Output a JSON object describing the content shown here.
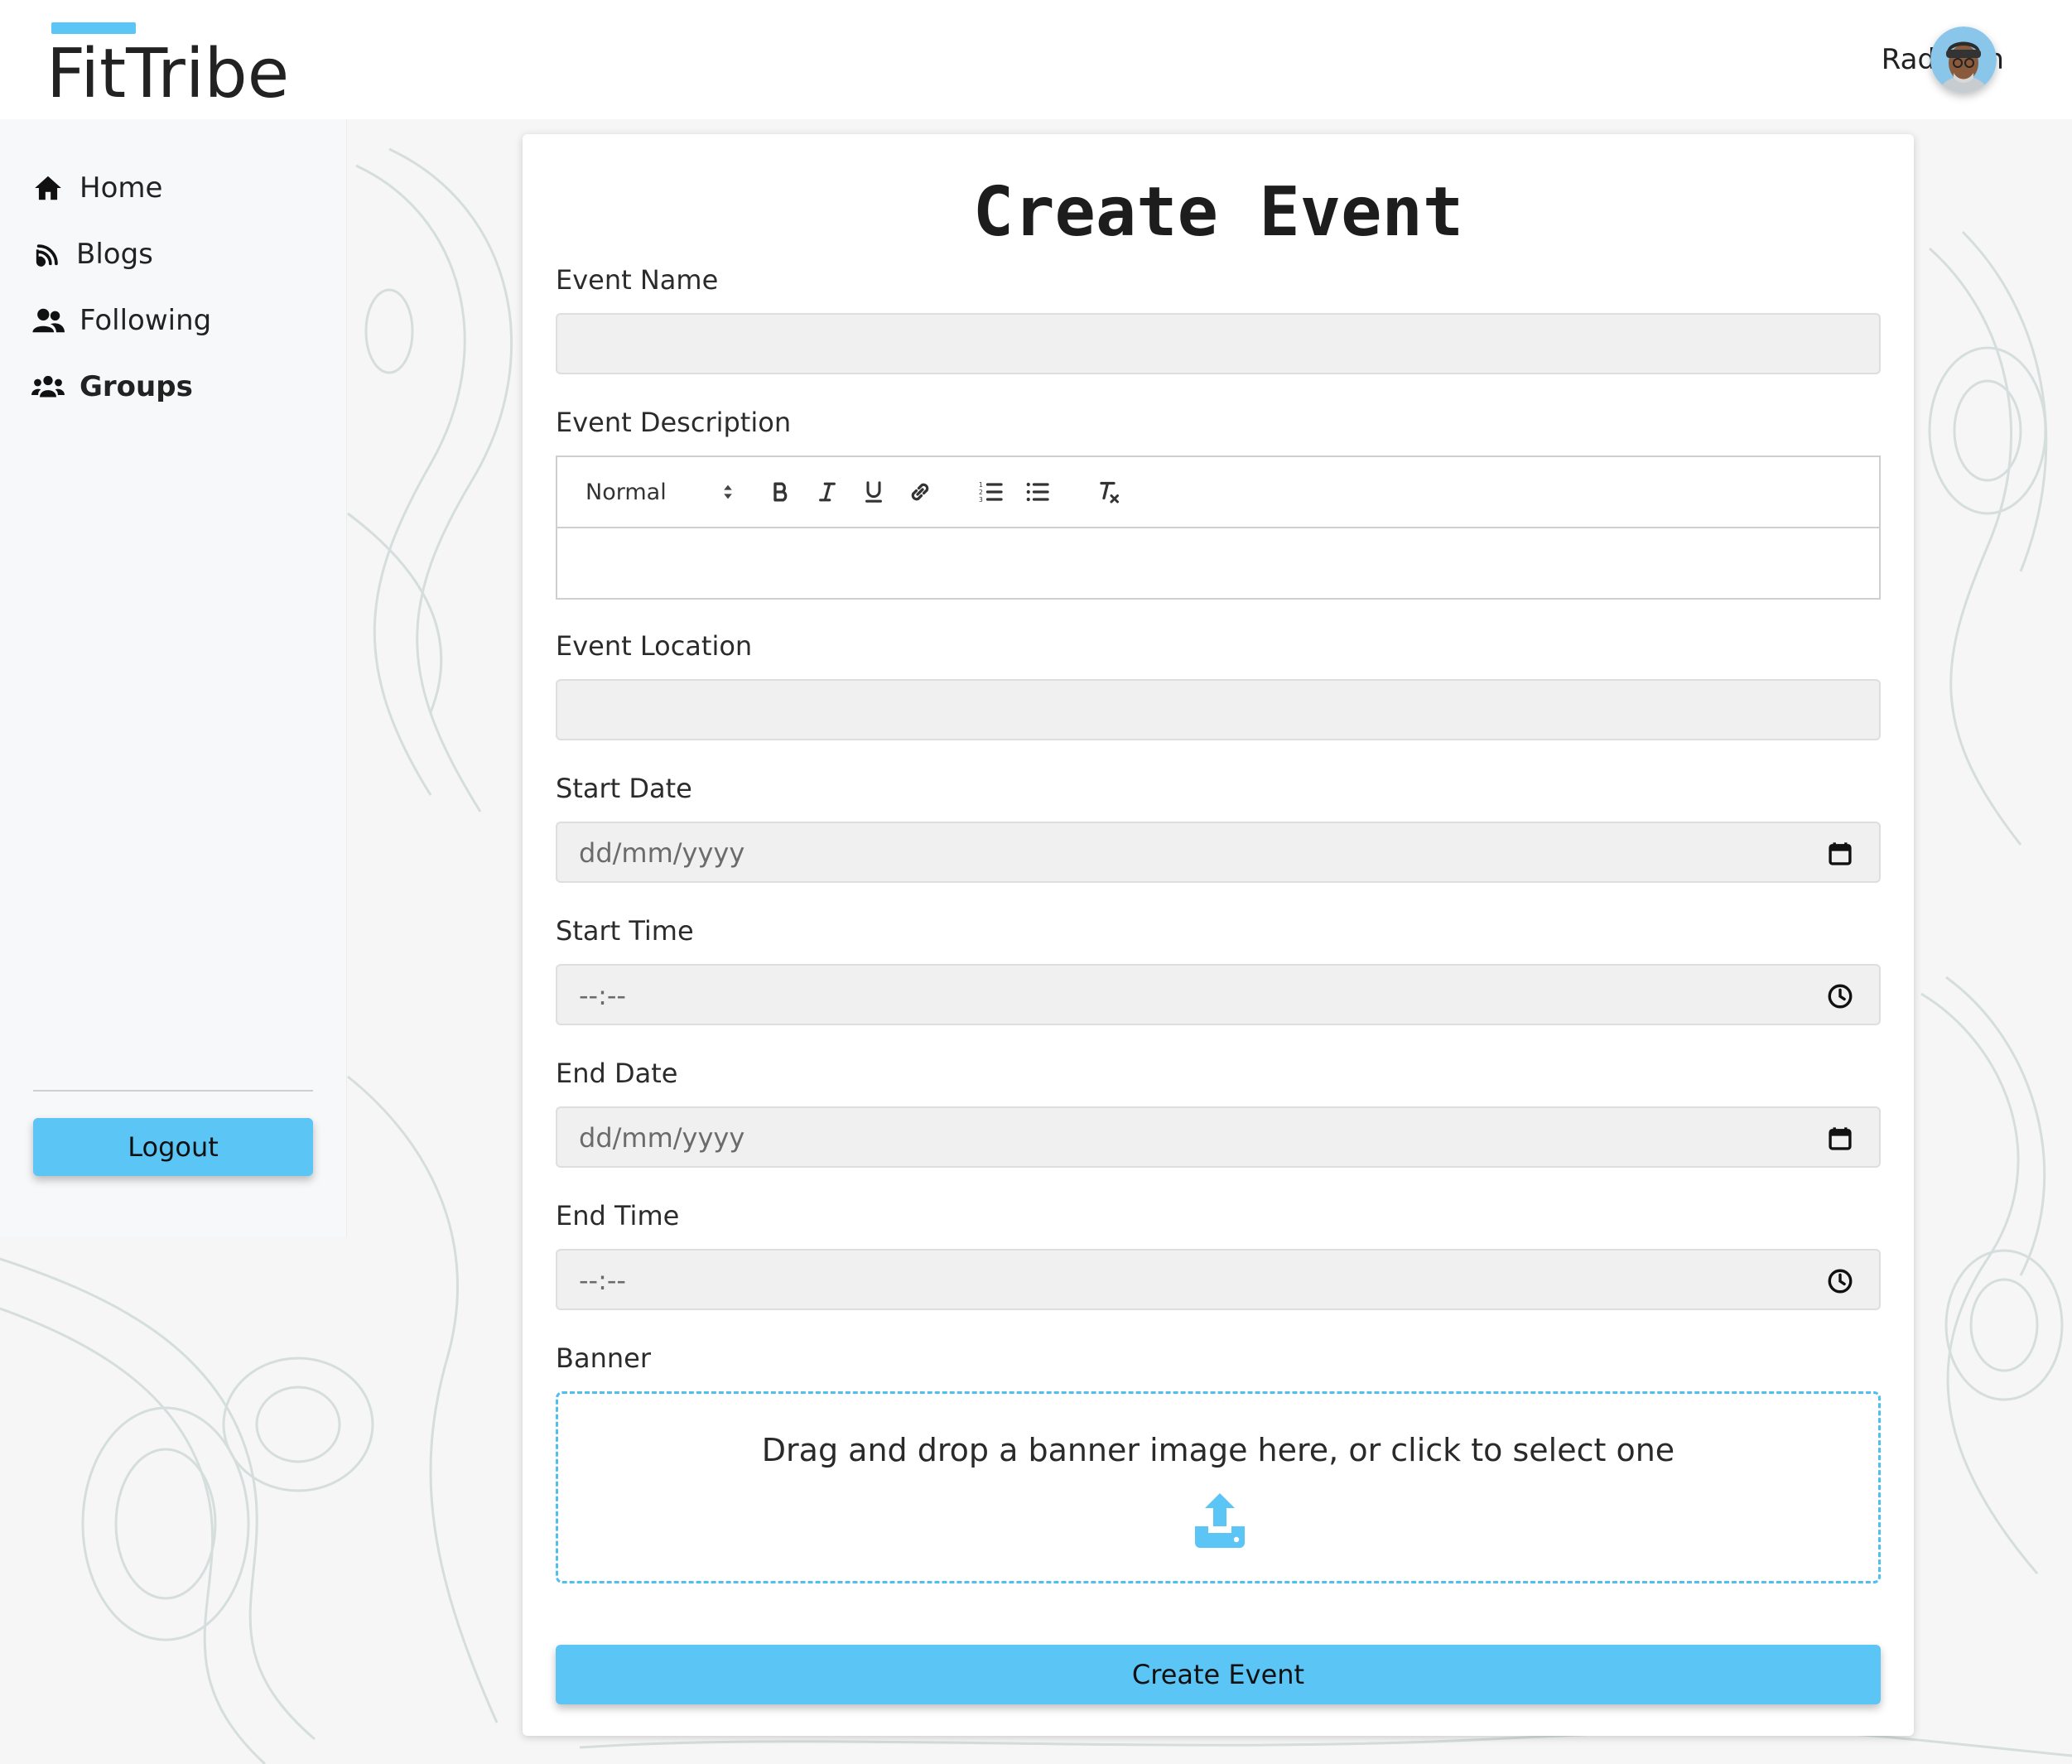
{
  "colors": {
    "accent": "#5bc5f6",
    "accent_dark": "#3fb2e8"
  },
  "header": {
    "logo_text": "FitTribe",
    "user_name": "Radleigh"
  },
  "sidebar": {
    "items": [
      {
        "label": "Home",
        "icon": "home-icon",
        "active": false
      },
      {
        "label": "Blogs",
        "icon": "rss-icon",
        "active": false
      },
      {
        "label": "Following",
        "icon": "user-group-icon",
        "active": false
      },
      {
        "label": "Groups",
        "icon": "users-icon",
        "active": true
      }
    ],
    "logout_label": "Logout"
  },
  "form": {
    "title": "Create Event",
    "event_name": {
      "label": "Event Name",
      "value": ""
    },
    "event_description": {
      "label": "Event Description",
      "format_select": "Normal",
      "toolbar_icons": [
        "bold-icon",
        "italic-icon",
        "underline-icon",
        "link-icon",
        "ordered-list-icon",
        "bullet-list-icon",
        "clear-format-icon"
      ],
      "value": ""
    },
    "event_location": {
      "label": "Event Location",
      "value": ""
    },
    "start_date": {
      "label": "Start Date",
      "placeholder": "dd/mm/yyyy",
      "icon": "calendar-icon"
    },
    "start_time": {
      "label": "Start Time",
      "placeholder": "--:--",
      "icon": "clock-icon"
    },
    "end_date": {
      "label": "End Date",
      "placeholder": "dd/mm/yyyy",
      "icon": "calendar-icon"
    },
    "end_time": {
      "label": "End Time",
      "placeholder": "--:--",
      "icon": "clock-icon"
    },
    "banner": {
      "label": "Banner",
      "dropzone_text": "Drag and drop a banner image here, or click to select one",
      "icon": "upload-icon"
    },
    "submit_label": "Create Event"
  }
}
